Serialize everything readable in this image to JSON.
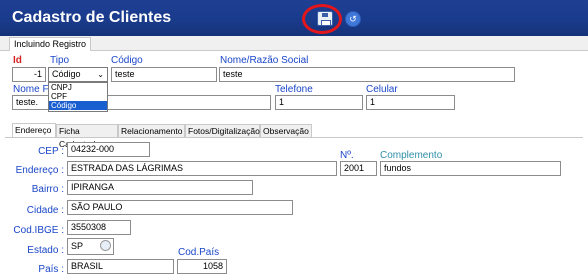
{
  "header": {
    "title": "Cadastro de Clientes",
    "save_icon": "save-icon",
    "undo_icon": "undo-icon",
    "highlight_color": "#e3161b"
  },
  "mode_tab": "Incluindo Registro",
  "labels": {
    "id": "Id",
    "tipo": "Tipo",
    "codigo": "Código",
    "nome": "Nome/Razão Social",
    "nome_fantasia": "Nome Fa",
    "telefone": "Telefone",
    "celular": "Celular"
  },
  "values": {
    "id": "-1",
    "tipo": "Código",
    "codigo": "teste",
    "nome": "teste",
    "nome_fantasia": "teste.",
    "telefone": "1",
    "celular": "1"
  },
  "tipo_options": [
    "CNPJ",
    "CPF",
    "Código"
  ],
  "tipo_selected": "Código",
  "tabs": [
    "Endereço",
    "Ficha Cadastral",
    "Relacionamento",
    "Fotos/Digitalização",
    "Observação"
  ],
  "address": {
    "cep_label": "CEP :",
    "cep": "04232-000",
    "endereco_label": "Endereço :",
    "endereco": "ESTRADA DAS LÁGRIMAS",
    "numero_label": "Nº.",
    "numero": "2001",
    "complemento_label": "Complemento",
    "complemento": "fundos",
    "bairro_label": "Bairro :",
    "bairro": "IPIRANGA",
    "cidade_label": "Cidade :",
    "cidade": "SÃO PAULO",
    "codibge_label": "Cod.IBGE :",
    "codibge": "3550308",
    "estado_label": "Estado :",
    "estado": "SP",
    "codpais_label": "Cod.País",
    "pais_label": "País :",
    "pais": "BRASIL",
    "codpais": "1058"
  }
}
